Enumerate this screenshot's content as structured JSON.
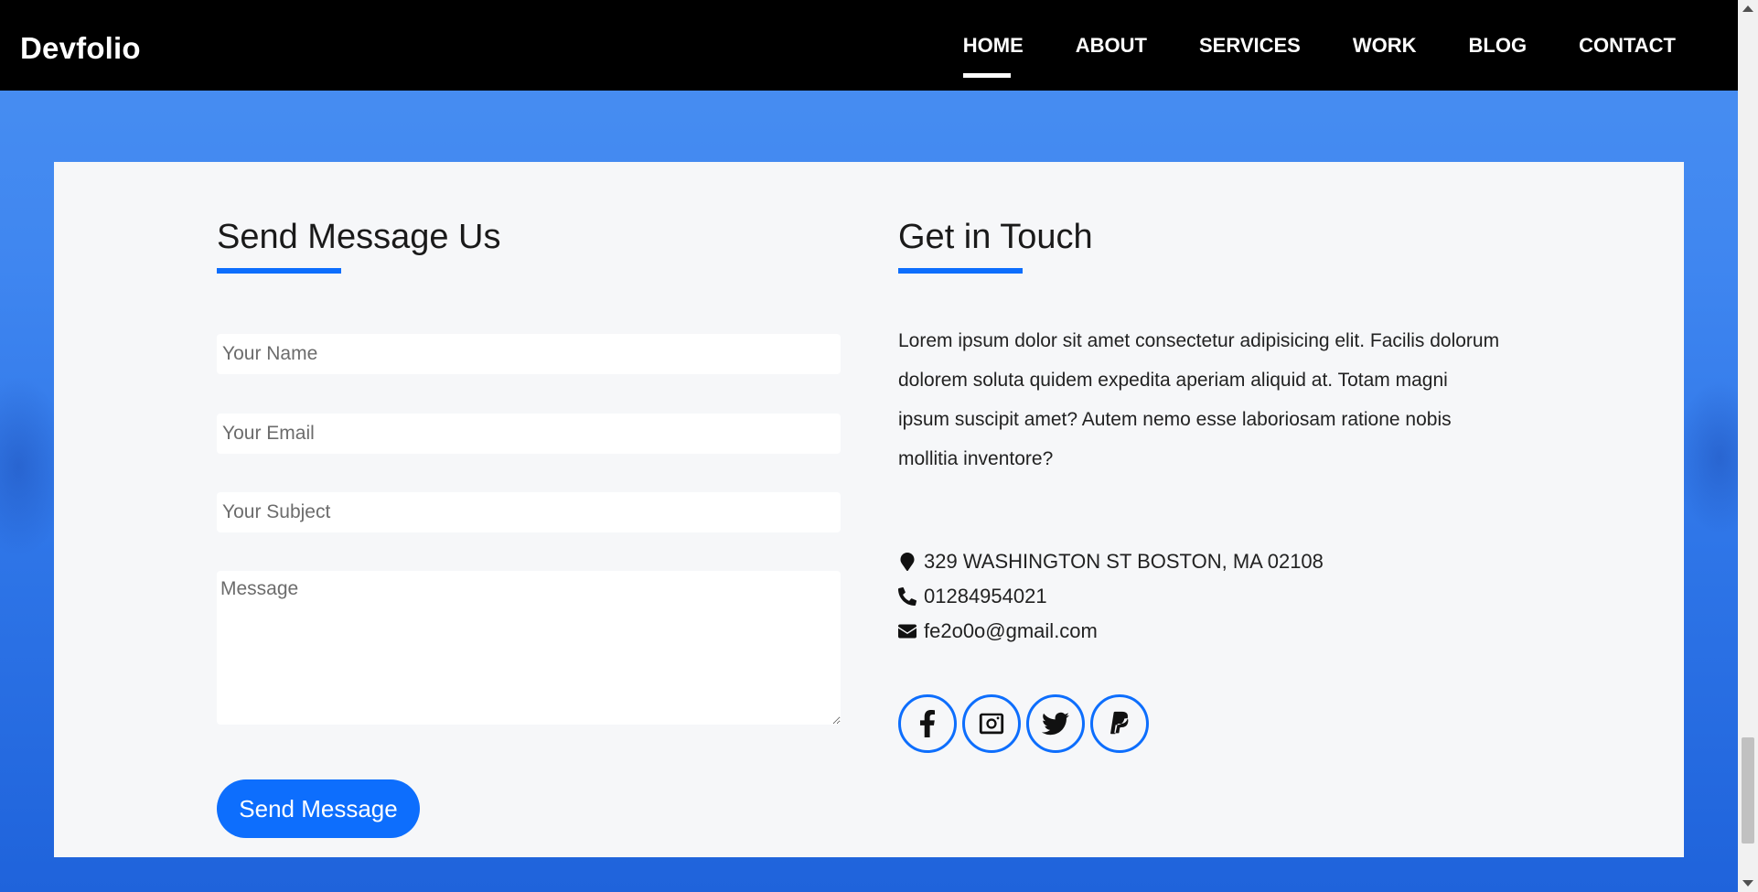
{
  "brand": {
    "name": "Devfolio"
  },
  "nav": {
    "items": [
      {
        "label": "HOME",
        "active": true
      },
      {
        "label": "ABOUT"
      },
      {
        "label": "SERVICES"
      },
      {
        "label": "WORK"
      },
      {
        "label": "BLOG"
      },
      {
        "label": "CONTACT"
      }
    ]
  },
  "contact_form": {
    "title": "Send Message Us",
    "name_placeholder": "Your Name",
    "email_placeholder": "Your Email",
    "subject_placeholder": "Your Subject",
    "message_placeholder": "Message",
    "submit_label": "Send Message"
  },
  "get_in_touch": {
    "title": "Get in Touch",
    "text": "Lorem ipsum dolor sit amet consectetur adipisicing elit. Facilis dolorum dolorem soluta quidem expedita aperiam aliquid at. Totam magni ipsum suscipit amet? Autem nemo esse laboriosam ratione nobis mollitia inventore?",
    "address": "329 WASHINGTON ST BOSTON, MA 02108",
    "phone": "01284954021",
    "email": "fe2o0o@gmail.com",
    "icons": {
      "address": "map-marker-icon",
      "phone": "phone-icon",
      "email": "envelope-icon"
    },
    "socials": [
      {
        "icon": "facebook-icon"
      },
      {
        "icon": "instagram-icon"
      },
      {
        "icon": "twitter-icon"
      },
      {
        "icon": "paypal-icon"
      }
    ]
  },
  "colors": {
    "accent": "#0d6efd",
    "navbar": "#000000",
    "card": "#f6f7f9",
    "background": "#3f86f0"
  }
}
